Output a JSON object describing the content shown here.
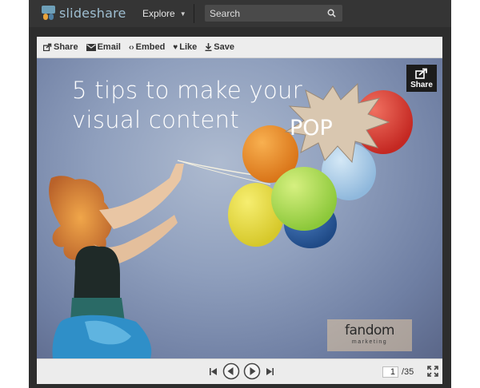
{
  "topbar": {
    "logo_text": "slideshare",
    "explore_label": "Explore",
    "search_placeholder": "Search"
  },
  "actions": [
    {
      "label": "Share",
      "icon": "share-icon"
    },
    {
      "label": "Email",
      "icon": "envelope-icon"
    },
    {
      "label": "Embed",
      "icon": "code-icon"
    },
    {
      "label": "Like",
      "icon": "heart-icon"
    },
    {
      "label": "Save",
      "icon": "download-icon"
    }
  ],
  "slide": {
    "title_line1": "5 tips to make your",
    "title_line2": "visual content",
    "pop_text": "POP",
    "share_label": "Share",
    "brand_name": "fandom",
    "brand_sub": "marketing"
  },
  "controls": {
    "current_page": "1",
    "total_pages": "/35"
  },
  "colors": {
    "topbar_bg": "#353535",
    "frame_bg": "#2d2d2d",
    "logo_text": "#9fbfd2",
    "balloon_red": "#d8322a",
    "balloon_orange": "#e88a24",
    "balloon_yellow": "#e5d83a",
    "balloon_green": "#a8d94a",
    "balloon_blue": "#2f5e9e",
    "balloon_lightblue": "#9fc7e6"
  }
}
